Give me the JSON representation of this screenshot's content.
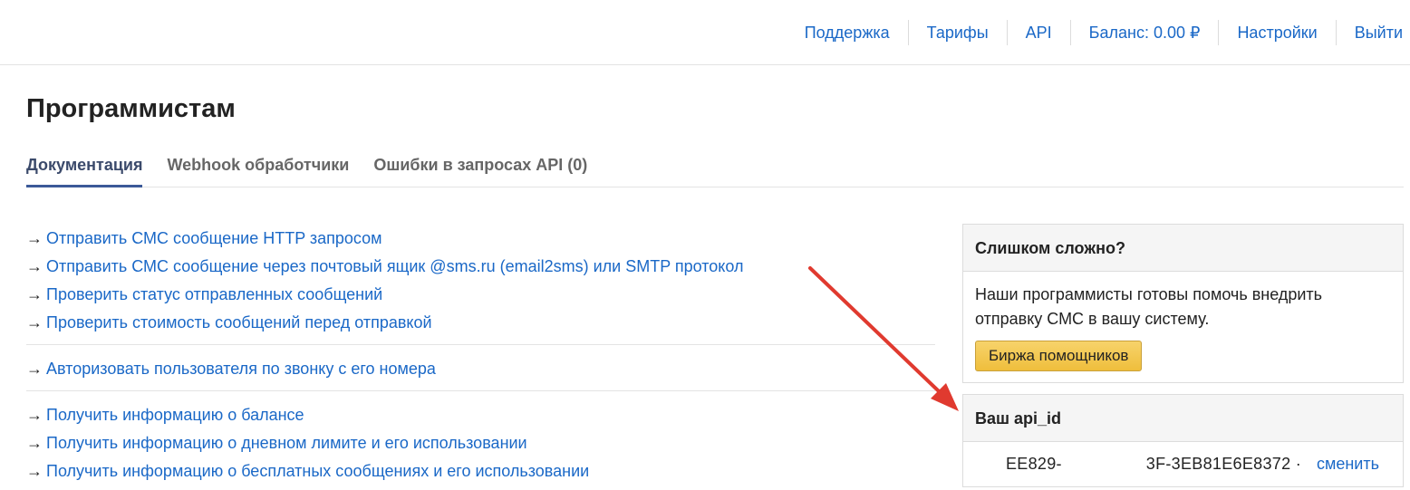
{
  "topnav": {
    "items": [
      "Поддержка",
      "Тарифы",
      "API",
      "Баланс: 0.00 ₽",
      "Настройки",
      "Выйти"
    ]
  },
  "page": {
    "title": "Программистам"
  },
  "tabs": [
    {
      "label": "Документация"
    },
    {
      "label": "Webhook обработчики"
    },
    {
      "label": "Ошибки в запросах API (0)"
    }
  ],
  "links": {
    "arrow": "→",
    "group1": [
      "Отправить СМС сообщение HTTP запросом",
      "Отправить СМС сообщение через почтовый ящик @sms.ru (email2sms) или SMTP протокол",
      "Проверить статус отправленных сообщений",
      "Проверить стоимость сообщений перед отправкой"
    ],
    "group2": [
      "Авторизовать пользователя по звонку с его номера"
    ],
    "group3": [
      "Получить информацию о балансе",
      "Получить информацию о дневном лимите и его использовании",
      "Получить информацию о бесплатных сообщениях и его использовании"
    ]
  },
  "help_panel": {
    "title": "Слишком сложно?",
    "text": "Наши программисты готовы помочь внедрить отправку СМС в вашу систему.",
    "button": "Биржа помощников"
  },
  "api_panel": {
    "title": "Ваш api_id",
    "value_start": "EE829-",
    "value_end": "3F-3EB81E6E8372 ·",
    "change_link": "сменить"
  },
  "colors": {
    "link": "#1a68c7",
    "tab_active_underline": "#3b5998",
    "button_yellow": "#efbe3c",
    "annotation_arrow": "#e03a2f"
  }
}
